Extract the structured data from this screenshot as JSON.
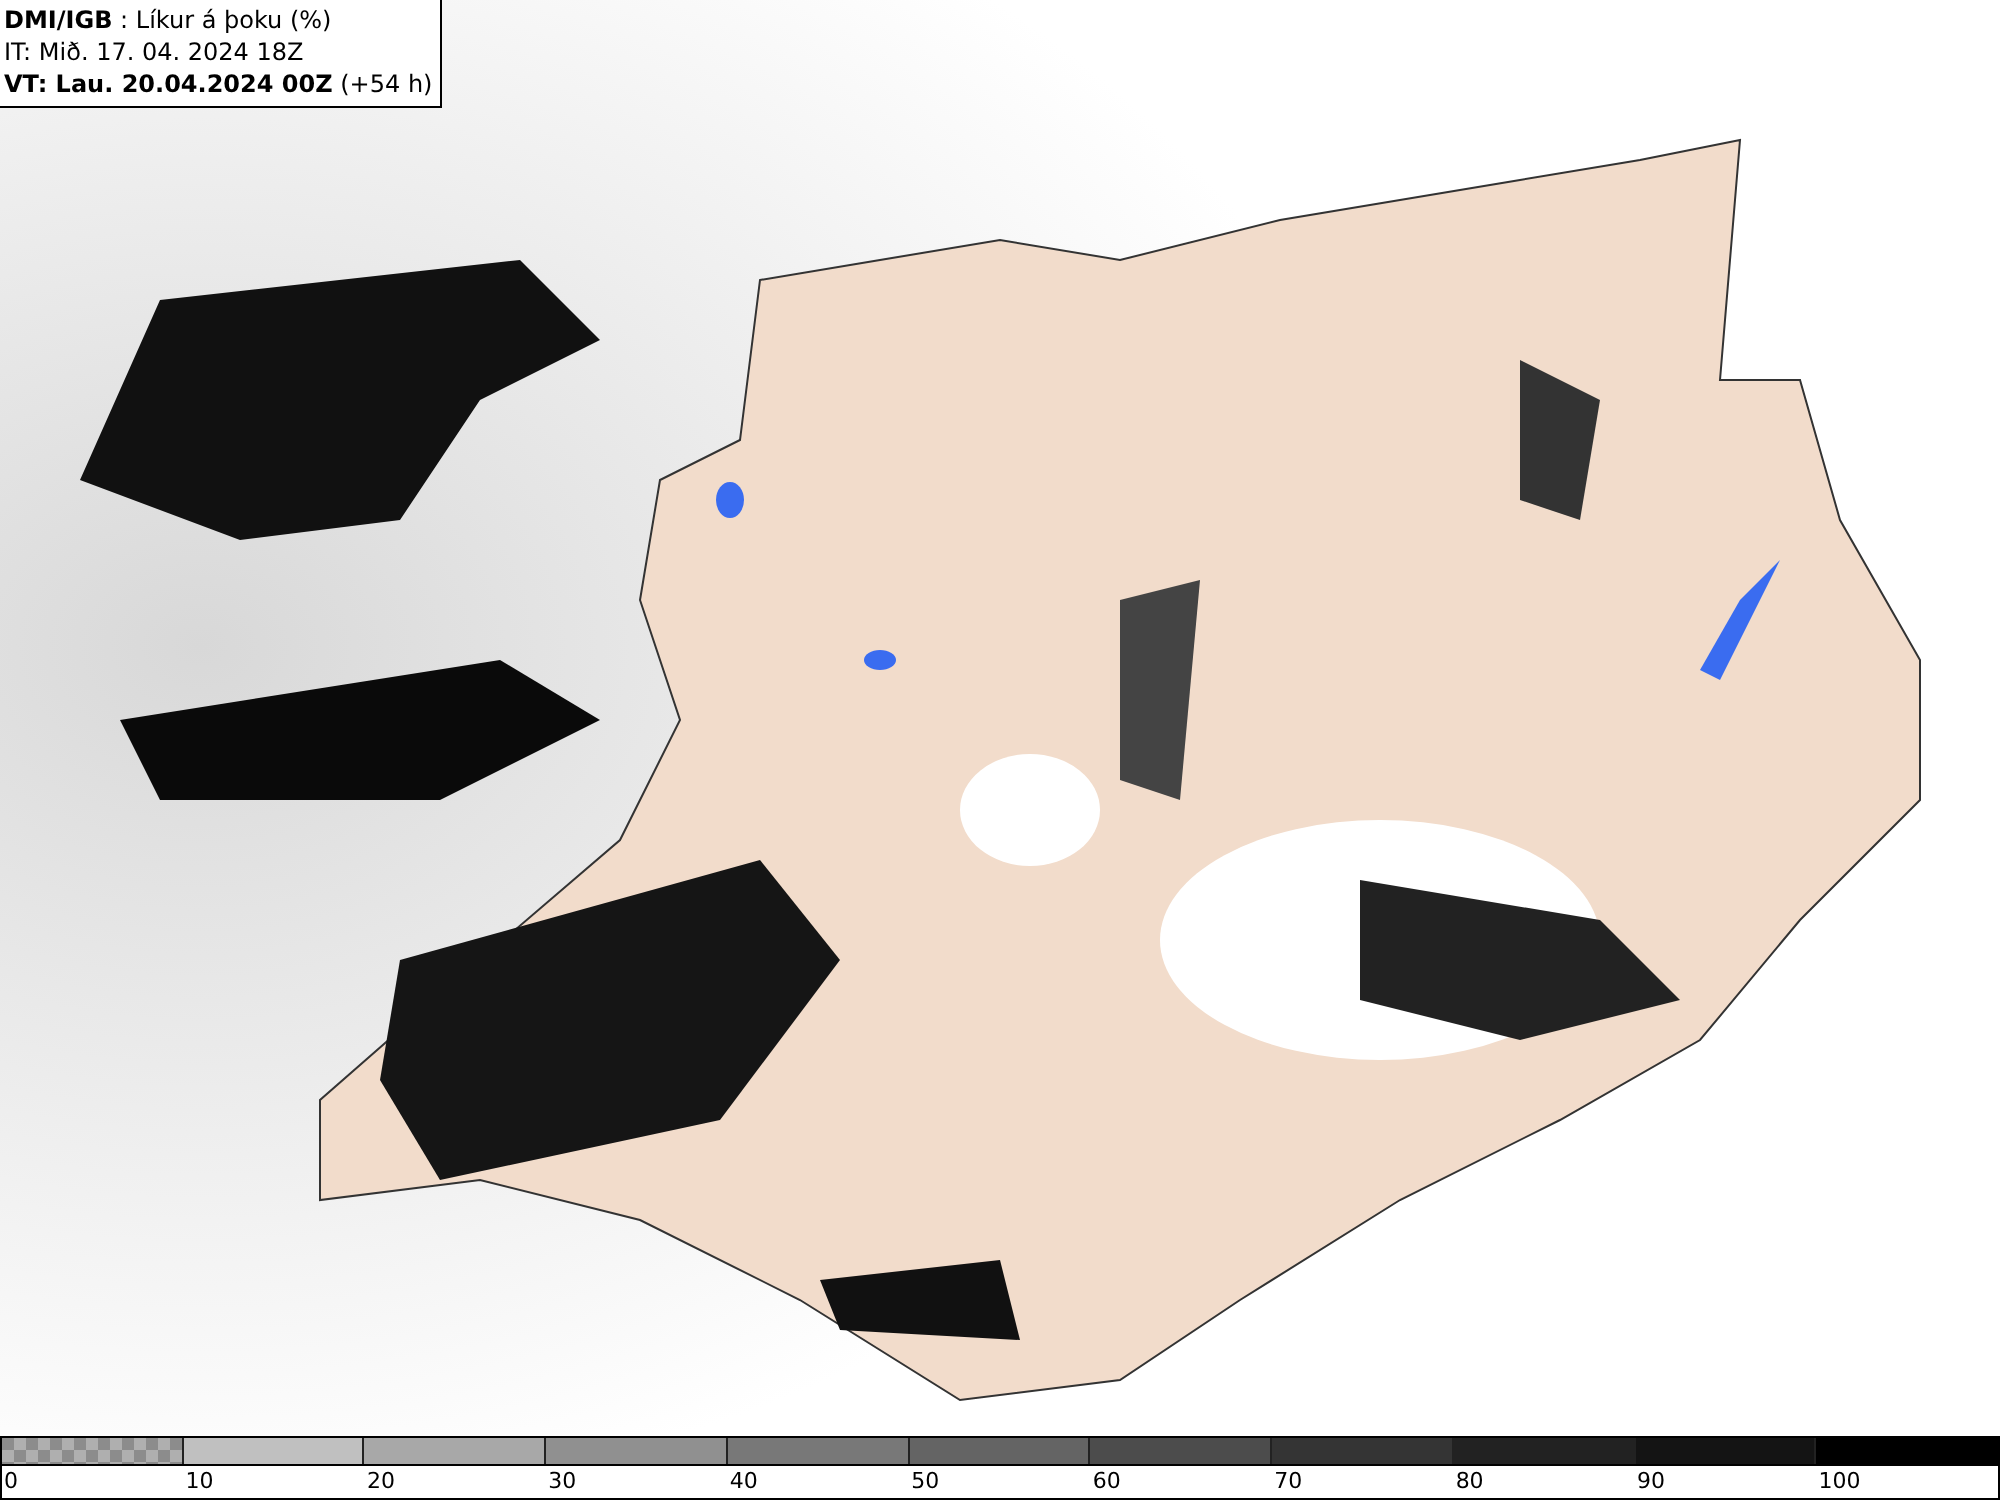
{
  "info_box": {
    "lines": [
      "**DMI/IGB** : Líkur á þoku (%)",
      "IT: Mið. 17. 04. 2024 18Z",
      "**VT: Lau. 20.04.2024 00Z** (+54 h)"
    ]
  },
  "legend": {
    "segments": [
      {
        "kind": "checkered",
        "color": "#8c8c8c"
      },
      {
        "kind": "solid",
        "color": "#c0c0c0"
      },
      {
        "kind": "solid",
        "color": "#a8a8a8"
      },
      {
        "kind": "solid",
        "color": "#909090"
      },
      {
        "kind": "solid",
        "color": "#787878"
      },
      {
        "kind": "solid",
        "color": "#646464"
      },
      {
        "kind": "solid",
        "color": "#4c4c4c"
      },
      {
        "kind": "solid",
        "color": "#343434"
      },
      {
        "kind": "solid",
        "color": "#222222"
      },
      {
        "kind": "solid",
        "color": "#141414"
      },
      {
        "kind": "solid",
        "color": "#000000"
      }
    ],
    "labels": [
      "0",
      "10",
      "20",
      "30",
      "40",
      "50",
      "60",
      "70",
      "80",
      "90",
      "100"
    ]
  }
}
